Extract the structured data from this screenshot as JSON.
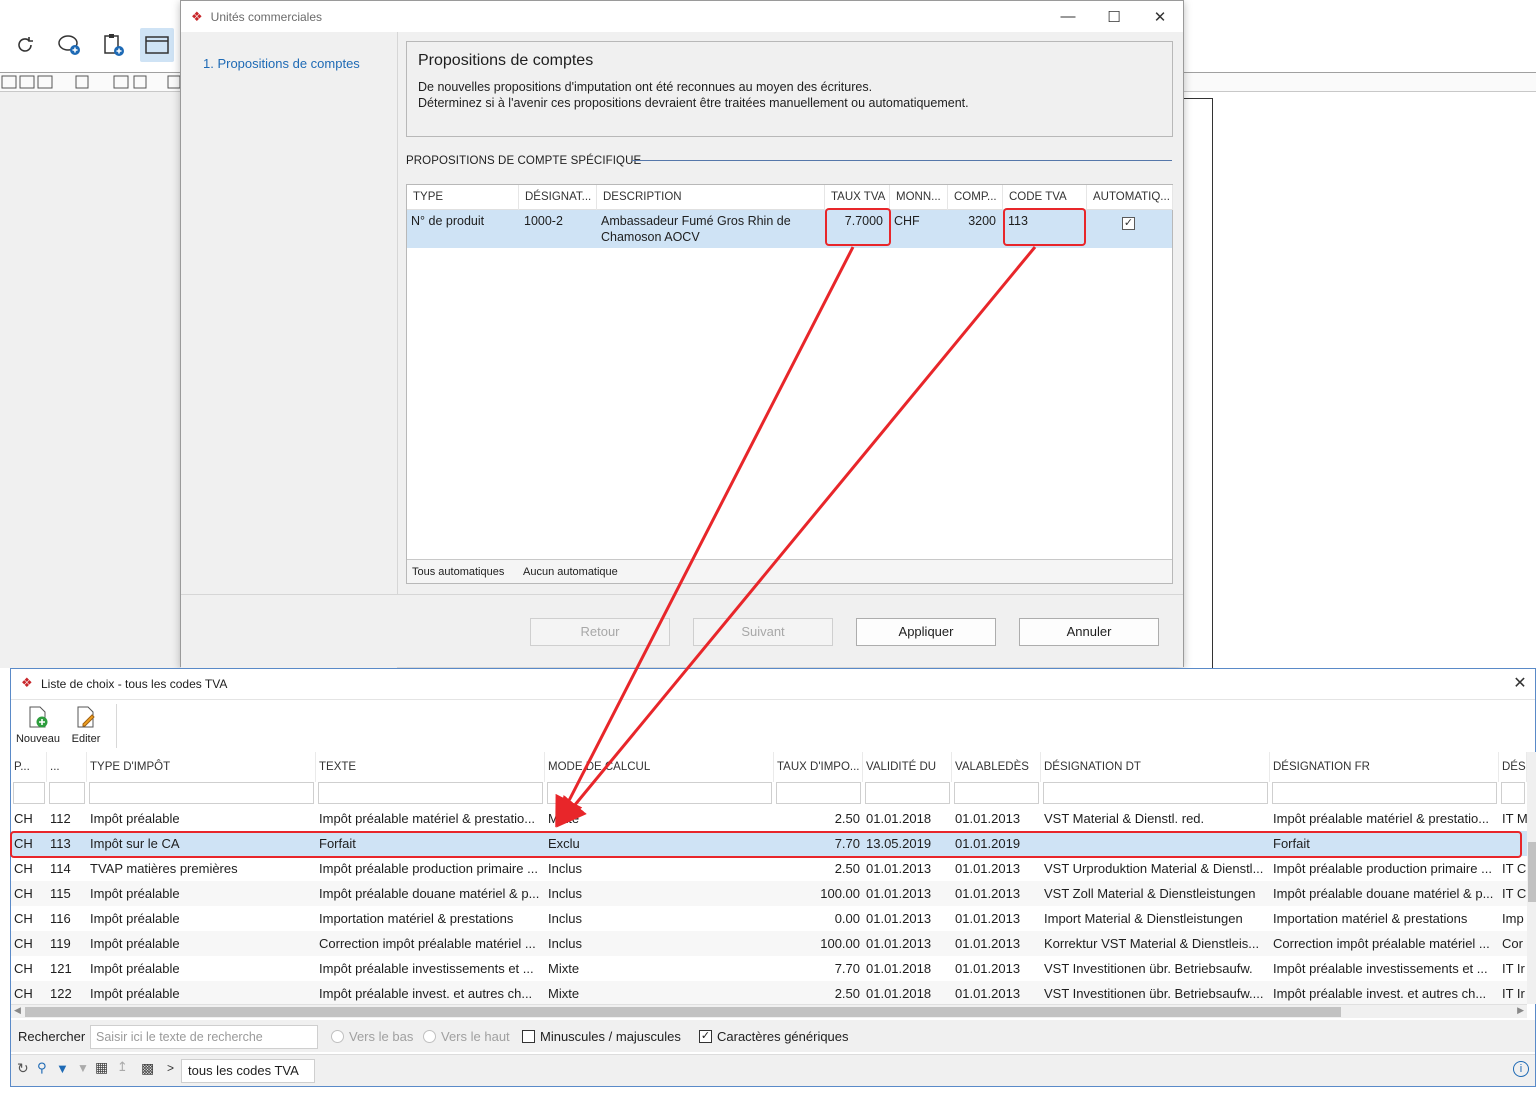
{
  "dialog": {
    "title": "Unités commerciales",
    "steps": [
      "1. Propositions de comptes"
    ],
    "info_title": "Propositions de comptes",
    "info_lines": [
      "De nouvelles propositions d'imputation ont été reconnues au moyen des écritures.",
      "Déterminez si à l'avenir ces propositions devraient être traitées manuellement ou automatiquement."
    ],
    "section_title": "PROPOSITIONS DE COMPTE SPÉCIFIQUE",
    "columns": [
      "TYPE",
      "DÉSIGNAT...",
      "DESCRIPTION",
      "TAUX TVA",
      "MONN...",
      "COMP...",
      "CODE TVA",
      "AUTOMATIQ..."
    ],
    "row": {
      "type": "N° de produit",
      "designation": "1000-2",
      "description_l1": "Ambassadeur Fumé Gros Rhin de",
      "description_l2": "Chamoson AOCV",
      "taux_tva": "7.7000",
      "monnaie": "CHF",
      "compte": "3200",
      "code_tva": "113",
      "automatique": true
    },
    "footer_all_auto": "Tous automatiques",
    "footer_no_auto": "Aucun automatique",
    "buttons": {
      "back": "Retour",
      "next": "Suivant",
      "apply": "Appliquer",
      "cancel": "Annuler"
    }
  },
  "lookup": {
    "title": "Liste de choix - tous les codes TVA",
    "tools": {
      "new": "Nouveau",
      "edit": "Editer"
    },
    "columns": [
      "P...",
      "...",
      "TYPE D'IMPÔT",
      "TEXTE",
      "MODE DE CALCUL",
      "TAUX D'IMPO...",
      "VALIDITÉ DU",
      "VALABLEDÈS",
      "DÉSIGNATION DT",
      "DÉSIGNATION FR",
      "DÉS"
    ],
    "rows": [
      [
        "CH",
        "112",
        "Impôt préalable",
        "Impôt préalable matériel & prestatio...",
        "Mixte",
        "2.50",
        "01.01.2018",
        "01.01.2013",
        "VST Material & Dienstl. red.",
        "Impôt préalable matériel & prestatio...",
        "IT M"
      ],
      [
        "CH",
        "113",
        "Impôt sur le CA",
        "Forfait",
        "Exclu",
        "7.70",
        "13.05.2019",
        "01.01.2019",
        "",
        "Forfait",
        ""
      ],
      [
        "CH",
        "114",
        "TVAP matières premières",
        "Impôt préalable production primaire ...",
        "Inclus",
        "2.50",
        "01.01.2013",
        "01.01.2013",
        "VST Urproduktion Material & Dienstl...",
        "Impôt préalable production primaire ...",
        "IT C"
      ],
      [
        "CH",
        "115",
        "Impôt préalable",
        "Impôt préalable douane matériel & p...",
        "Inclus",
        "100.00",
        "01.01.2013",
        "01.01.2013",
        "VST Zoll Material & Dienstleistungen",
        "Impôt préalable douane matériel & p...",
        "IT C"
      ],
      [
        "CH",
        "116",
        "Impôt préalable",
        "Importation matériel & prestations",
        "Inclus",
        "0.00",
        "01.01.2013",
        "01.01.2013",
        "Import Material & Dienstleistungen",
        "Importation matériel & prestations",
        "Imp"
      ],
      [
        "CH",
        "119",
        "Impôt préalable",
        "Correction impôt préalable matériel ...",
        "Inclus",
        "100.00",
        "01.01.2013",
        "01.01.2013",
        "Korrektur VST Material & Dienstleis...",
        "Correction impôt préalable matériel ...",
        "Cor"
      ],
      [
        "CH",
        "121",
        "Impôt préalable",
        "Impôt préalable investissements et ...",
        "Mixte",
        "7.70",
        "01.01.2018",
        "01.01.2013",
        "VST Investitionen übr. Betriebsaufw.",
        "Impôt préalable investissements et ...",
        "IT Ir"
      ],
      [
        "CH",
        "122",
        "Impôt préalable",
        "Impôt préalable invest.  et autres ch...",
        "Mixte",
        "2.50",
        "01.01.2018",
        "01.01.2013",
        "VST Investitionen übr. Betriebsaufw....",
        "Impôt préalable invest.  et autres ch...",
        "IT Ir"
      ]
    ],
    "selected_index": 1,
    "search": {
      "label": "Rechercher",
      "placeholder": "Saisir ici le texte de recherche",
      "down": "Vers le bas",
      "up": "Vers le haut",
      "case": "Minuscules / majuscules",
      "wildcards": "Caractères génériques"
    },
    "breadcrumb": "tous les codes TVA"
  },
  "colors": {
    "accent": "#1e6ab5",
    "selection": "#cfe3f5",
    "annotation": "#e8262a"
  }
}
